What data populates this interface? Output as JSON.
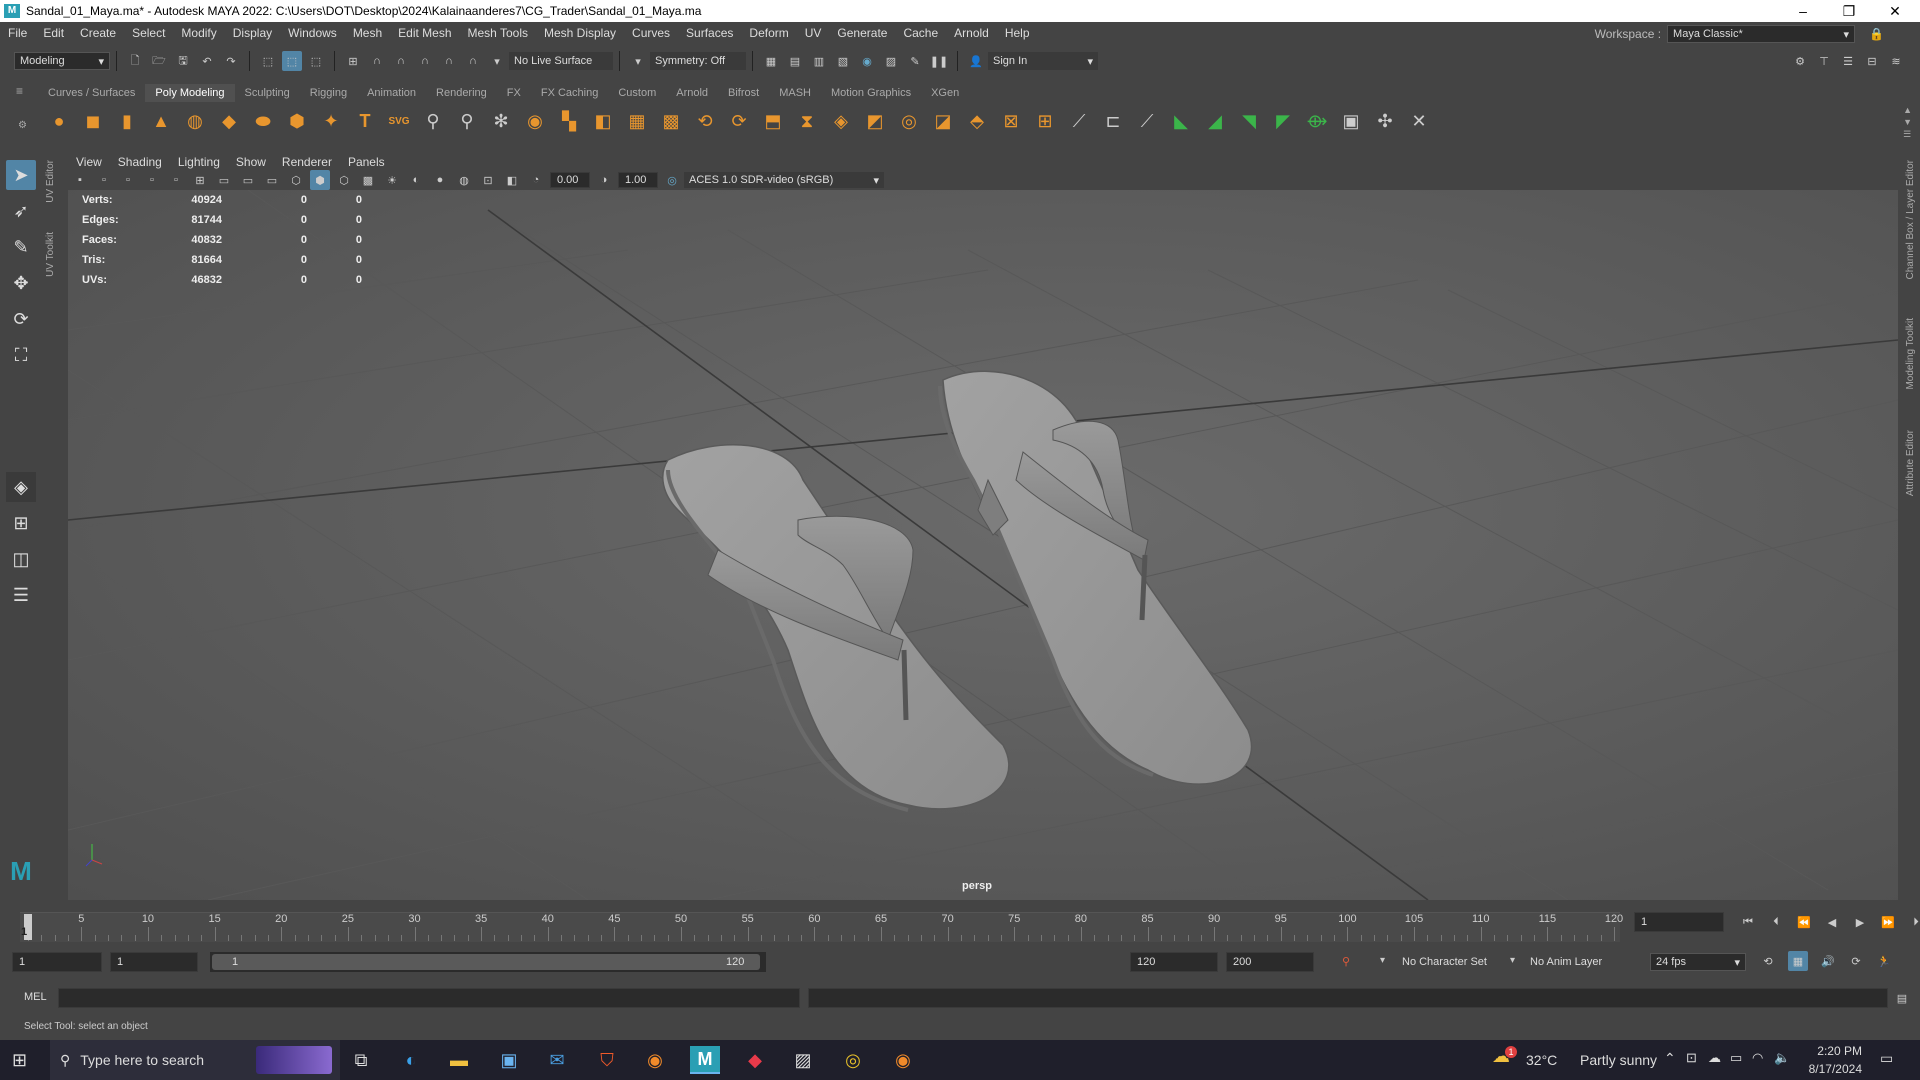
{
  "window": {
    "title": "Sandal_01_Maya.ma* - Autodesk MAYA 2022: C:\\Users\\DOT\\Desktop\\2024\\Kalainaanderes7\\CG_Trader\\Sandal_01_Maya.ma",
    "logo": "M"
  },
  "menubar": {
    "items": [
      "File",
      "Edit",
      "Create",
      "Select",
      "Modify",
      "Display",
      "Windows",
      "Mesh",
      "Edit Mesh",
      "Mesh Tools",
      "Mesh Display",
      "Curves",
      "Surfaces",
      "Deform",
      "UV",
      "Generate",
      "Cache",
      "Arnold",
      "Help"
    ],
    "workspace_label": "Workspace :",
    "workspace_value": "Maya Classic*"
  },
  "statusline": {
    "mode": "Modeling",
    "live_surface": "No Live Surface",
    "symmetry": "Symmetry: Off",
    "sign_in": "Sign In"
  },
  "shelf": {
    "tabs": [
      "Curves / Surfaces",
      "Poly Modeling",
      "Sculpting",
      "Rigging",
      "Animation",
      "Rendering",
      "FX",
      "FX Caching",
      "Custom",
      "Arnold",
      "Bifrost",
      "MASH",
      "Motion Graphics",
      "XGen"
    ],
    "active_tab": "Poly Modeling",
    "text_icon": "T",
    "svg_icon": "SVG"
  },
  "viewport": {
    "menus": [
      "View",
      "Shading",
      "Lighting",
      "Show",
      "Renderer",
      "Panels"
    ],
    "exposure": "0.00",
    "gamma": "1.00",
    "color_space": "ACES 1.0 SDR-video (sRGB)",
    "camera_label": "persp",
    "hud": [
      {
        "label": "Verts:",
        "value": "40924",
        "a": "0",
        "b": "0"
      },
      {
        "label": "Edges:",
        "value": "81744",
        "a": "0",
        "b": "0"
      },
      {
        "label": "Faces:",
        "value": "40832",
        "a": "0",
        "b": "0"
      },
      {
        "label": "Tris:",
        "value": "81664",
        "a": "0",
        "b": "0"
      },
      {
        "label": "UVs:",
        "value": "46832",
        "a": "0",
        "b": "0"
      }
    ]
  },
  "side_tabs": {
    "left": [
      "UV Editor",
      "UV Toolkit"
    ],
    "right": [
      "Channel Box / Layer Editor",
      "Modeling Toolkit",
      "Attribute Editor"
    ]
  },
  "timeline": {
    "ticks": [
      "5",
      "10",
      "15",
      "20",
      "25",
      "30",
      "35",
      "40",
      "45",
      "50",
      "55",
      "60",
      "65",
      "70",
      "75",
      "80",
      "85",
      "90",
      "95",
      "100",
      "105",
      "110",
      "115",
      "120"
    ],
    "current_frame_marker": "1",
    "current_frame": "1"
  },
  "range": {
    "start": "1",
    "playback_start": "1",
    "slider_start": "1",
    "slider_end": "120",
    "playback_end": "120",
    "end": "200",
    "character_set": "No Character Set",
    "anim_layer": "No Anim Layer",
    "fps": "24 fps"
  },
  "cmdline": {
    "label": "MEL"
  },
  "helpline": {
    "text": "Select Tool: select an object"
  },
  "taskbar": {
    "search_placeholder": "Type here to search",
    "weather_temp": "32°C",
    "weather_text": "Partly sunny",
    "time": "2:20 PM",
    "date": "8/17/2024",
    "weather_badge": "1"
  },
  "colors": {
    "accent": "#5285a6",
    "maya_teal": "#2a9fb4",
    "shelf_orange": "#e8962e",
    "shelf_green": "#3bb54a"
  }
}
